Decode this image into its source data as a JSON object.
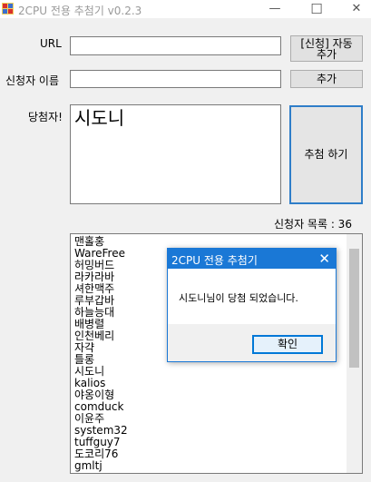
{
  "window": {
    "title": "2CPU 전용 추첨기 v0.2.3",
    "minimize_glyph": "—",
    "maximize_glyph": "☐",
    "close_glyph": "✕"
  },
  "form": {
    "url_label": "URL",
    "url_value": "",
    "name_label": "신청자 이름",
    "name_value": "",
    "auto_add_button": "[신청] 자동\n추가",
    "add_button": "추가",
    "winner_label": "당첨자!",
    "winner_value": "시도니",
    "draw_button": "추첨 하기",
    "applicant_count": "신청자 목록 : 36"
  },
  "applicants": [
    "맨홀홍",
    "WareFree",
    "허밍버드",
    "라카라바",
    "셔한맥주",
    "루부갑바",
    "하늘능대",
    "배병렬",
    "인천베리",
    "자갹",
    "틀롱",
    "시도니",
    "kalios",
    "야옹이형",
    "comduck",
    "이윤주",
    "system32",
    "tuffguy7",
    "도코리76",
    "gmltj"
  ],
  "dialog": {
    "title": "2CPU 전용 추첨기",
    "message": "시도니님이 당첨 되었습니다.",
    "ok_button": "확인",
    "close_glyph": "✕"
  },
  "colors": {
    "accent": "#1a78d6",
    "window_bg": "#f0f0f0"
  }
}
